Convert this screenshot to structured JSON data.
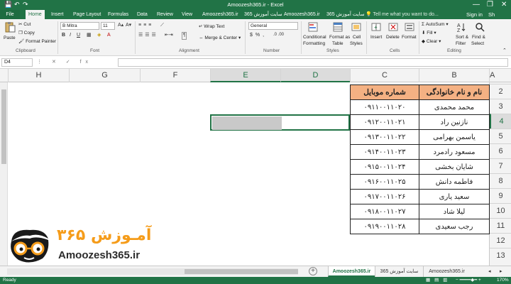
{
  "titlebar": {
    "title": "Amoozesh365.ir - Excel",
    "save_glyph": "💾",
    "undo_glyph": "↶",
    "redo_glyph": "↷",
    "minimize_glyph": "—",
    "restore_glyph": "❐",
    "close_glyph": "✕"
  },
  "tabs": {
    "file": "File",
    "items": [
      "Home",
      "Insert",
      "Page Layout",
      "Formulas",
      "Data",
      "Review",
      "View",
      "Amoozesh365.ir",
      "سایت آموزش 365",
      "Amoozesh365.ir",
      "سایت آموزش 365"
    ],
    "tell_me": "Tell me what you want to do...",
    "sign_in": "Sign in",
    "share": "Sh"
  },
  "ribbon": {
    "clipboard": {
      "paste": "Paste",
      "cut": "Cut",
      "copy": "Copy",
      "format_painter": "Format Painter",
      "label": "Clipboard"
    },
    "font": {
      "name": "B Mitra",
      "size": "11",
      "label": "Font"
    },
    "alignment": {
      "wrap_text": "Wrap Text",
      "merge_center": "Merge & Center",
      "label": "Alignment"
    },
    "number": {
      "format": "General",
      "label": "Number"
    },
    "styles": {
      "conditional": "Conditional",
      "formatting": "Formatting",
      "format_as": "Format as",
      "table": "Table",
      "cell": "Cell",
      "styles_btn": "Styles",
      "label": "Styles"
    },
    "cells": {
      "insert": "Insert",
      "delete": "Delete",
      "format": "Format",
      "label": "Cells"
    },
    "editing": {
      "autosum": "AutoSum",
      "fill": "Fill",
      "clear": "Clear",
      "sort": "Sort &",
      "filter": "Filter",
      "find": "Find &",
      "select": "Select",
      "label": "Editing"
    }
  },
  "formula_bar": {
    "name_box": "D4",
    "icons": "⋮ ✕ ✓ fx",
    "value": ""
  },
  "grid": {
    "columns": [
      "H",
      "G",
      "F",
      "E",
      "D",
      "C",
      "B",
      "A"
    ],
    "selected_column": "E",
    "rows": [
      "2",
      "3",
      "4",
      "5",
      "6",
      "7",
      "8",
      "9",
      "10",
      "11",
      "12",
      "13"
    ],
    "selected_row": "4"
  },
  "table": {
    "headers": [
      "شماره موبایل",
      "نام و نام خانوادگی"
    ],
    "rows": [
      [
        "۰۹۱۱۰۰۱۱۰۲۰",
        "محمد محمدی"
      ],
      [
        "۰۹۱۲۰۰۱۱۰۲۱",
        "نازنین راد"
      ],
      [
        "۰۹۱۳۰۰۱۱۰۲۲",
        "یاسمن بهرامی"
      ],
      [
        "۰۹۱۴۰۰۱۱۰۲۳",
        "مسعود رادمرد"
      ],
      [
        "۰۹۱۵۰۰۱۱۰۲۴",
        "شایان بخشی"
      ],
      [
        "۰۹۱۶۰۰۱۱۰۲۵",
        "فاطمه دانش"
      ],
      [
        "۰۹۱۷۰۰۱۱۰۲۶",
        "سعید یاری"
      ],
      [
        "۰۹۱۸۰۰۱۱۰۲۷",
        "لیلا شاد"
      ],
      [
        "۰۹۱۹۰۰۱۱۰۲۸",
        "رجب سعیدی"
      ]
    ],
    "header_color": "#f4b183"
  },
  "logo": {
    "text_fa": "آمـوزش ۳۶۵",
    "text_en": "Amoozesh365.ir"
  },
  "sheets": {
    "tabs": [
      "Amoozesh365.ir",
      "سایت آموزش 365",
      "Amoozesh365.ir"
    ],
    "active_index": 0
  },
  "statusbar": {
    "ready": "Ready",
    "zoom": "170%"
  },
  "colors": {
    "accent": "#217346",
    "selection_fill": "#c9c9c9"
  }
}
